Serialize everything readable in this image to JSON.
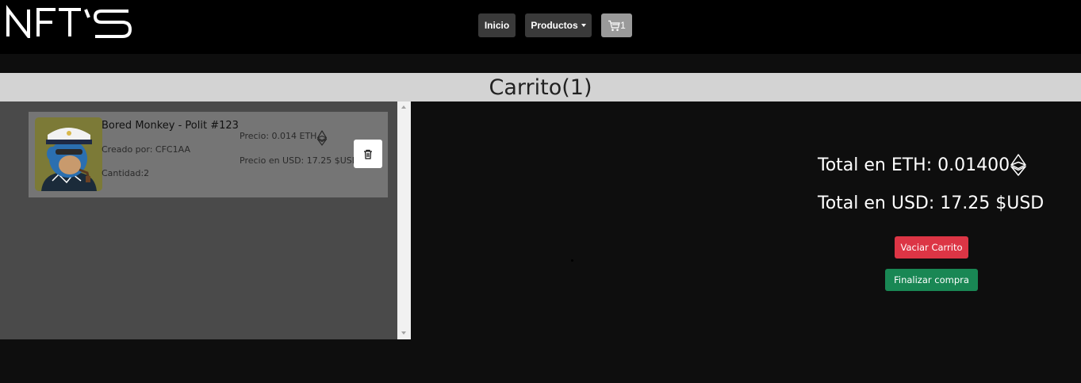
{
  "brand": {
    "logo_text": "NFT'S"
  },
  "nav": {
    "inicio_label": "Inicio",
    "productos_label": "Productos",
    "cart_count": "1",
    "cart_icon": "cart-icon"
  },
  "page": {
    "title": "Carrito(1)"
  },
  "cart": {
    "items": [
      {
        "name": "Bored Monkey - Polit #123",
        "creator": "Creado por: CFC1AA",
        "quantity": "Cantidad:2",
        "price_eth": "Precio: 0.014 ETH",
        "price_usd": "Precio en USD: 17.25 $USD",
        "image": "bored-ape-nft-image",
        "delete_icon": "trash-icon"
      }
    ]
  },
  "summary": {
    "total_eth": "Total en ETH: 0.01400",
    "total_usd": "Total en USD: 17.25 $USD",
    "eth_icon": "ethereum-icon",
    "empty_button": "Vaciar Carrito",
    "checkout_button": "Finalizar compra"
  },
  "colors": {
    "navbar": "#000000",
    "background": "#0e0e0e",
    "danger": "#dc3545",
    "success": "#198754"
  }
}
